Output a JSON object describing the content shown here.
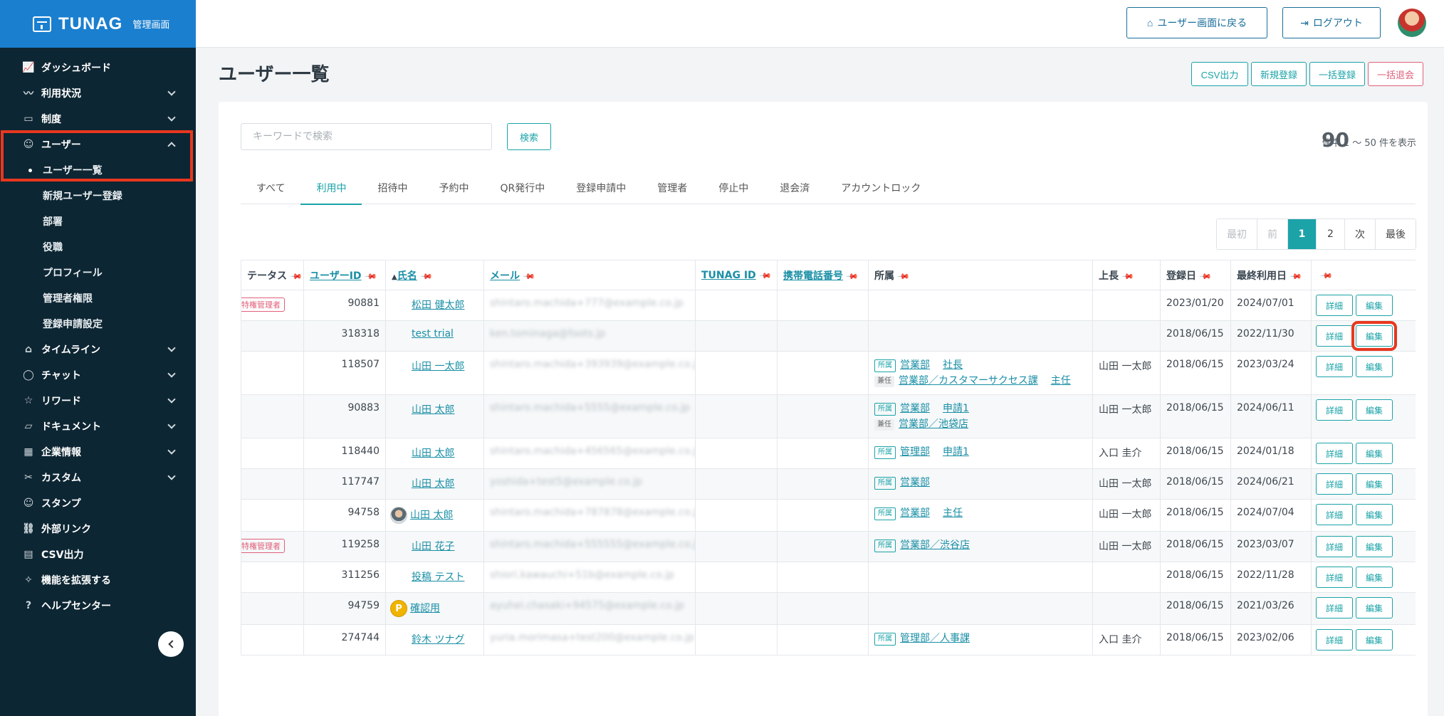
{
  "brand": {
    "name": "TUNAG",
    "sub": "管理画面"
  },
  "sidebar": {
    "items": [
      {
        "label": "ダッシュボード",
        "icon": "chart-icon",
        "glyph": "📈",
        "chevron": "none"
      },
      {
        "label": "利用状況",
        "icon": "activity-icon",
        "glyph": "〰",
        "chevron": "down"
      },
      {
        "label": "制度",
        "icon": "book-icon",
        "glyph": "▭",
        "chevron": "down"
      },
      {
        "label": "ユーザー",
        "icon": "users-icon",
        "glyph": "☺",
        "chevron": "up"
      }
    ],
    "user_sub": [
      "ユーザー一覧",
      "新規ユーザー登録",
      "部署",
      "役職",
      "プロフィール",
      "管理者権限",
      "登録申請設定"
    ],
    "bottom_items": [
      {
        "label": "タイムライン",
        "icon": "home-icon",
        "glyph": "⌂",
        "chevron": "down"
      },
      {
        "label": "チャット",
        "icon": "chat-icon",
        "glyph": "◯",
        "chevron": "down"
      },
      {
        "label": "リワード",
        "icon": "star-icon",
        "glyph": "☆",
        "chevron": "down"
      },
      {
        "label": "ドキュメント",
        "icon": "folder-icon",
        "glyph": "▱",
        "chevron": "down"
      },
      {
        "label": "企業情報",
        "icon": "building-icon",
        "glyph": "▦",
        "chevron": "down"
      },
      {
        "label": "カスタム",
        "icon": "custom-icon",
        "glyph": "✂",
        "chevron": "down"
      },
      {
        "label": "スタンプ",
        "icon": "smile-icon",
        "glyph": "☺",
        "chevron": "none"
      },
      {
        "label": "外部リンク",
        "icon": "link-icon",
        "glyph": "⛓",
        "chevron": "none"
      },
      {
        "label": "CSV出力",
        "icon": "table-icon",
        "glyph": "▤",
        "chevron": "none"
      },
      {
        "label": "機能を拡張する",
        "icon": "sparkle-icon",
        "glyph": "✧",
        "chevron": "none"
      },
      {
        "label": "ヘルプセンター",
        "icon": "help-icon",
        "glyph": "?",
        "chevron": "none"
      }
    ]
  },
  "topbar": {
    "back_label": "ユーザー画面に戻る",
    "logout_label": "ログアウト"
  },
  "page": {
    "title": "ユーザー一覧",
    "actions": {
      "csv": "CSV出力",
      "new": "新規登録",
      "bulk": "一括登録",
      "bulk_withdraw": "一括退会"
    }
  },
  "search": {
    "placeholder": "キーワードで検索",
    "button": "検索"
  },
  "summary": {
    "count": "90",
    "text": "件中 1 〜 50 件を表示"
  },
  "tabs": [
    "すべて",
    "利用中",
    "招待中",
    "予約中",
    "QR発行中",
    "登録申請中",
    "管理者",
    "停止中",
    "退会済",
    "アカウントロック"
  ],
  "active_tab": 1,
  "pagination": {
    "first": "最初",
    "prev": "前",
    "pages": [
      "1",
      "2"
    ],
    "current": "1",
    "next": "次",
    "last": "最後"
  },
  "table": {
    "headers": {
      "status": "テータス",
      "user_id": "ユーザーID",
      "name": "氏名",
      "email": "メール",
      "tunag_id": "TUNAG ID",
      "phone": "携帯電話番号",
      "affiliation": "所属",
      "manager": "上長",
      "registered": "登録日",
      "last_used": "最終利用日"
    },
    "labels": {
      "primary": "所属",
      "secondary": "兼任",
      "detail": "詳細",
      "edit": "編集"
    },
    "rows": [
      {
        "status": "特権管理者",
        "id": "90881",
        "name": "松田 健太郎",
        "avatar": "",
        "email": "shintaro.machida+777@example.co.jp",
        "aff": [],
        "manager": "",
        "reg": "2023/01/20",
        "last": "2024/07/01"
      },
      {
        "status": "",
        "id": "318318",
        "name": "test trial",
        "avatar": "",
        "email": "ken.tominaga@foots.jp",
        "aff": [],
        "manager": "",
        "reg": "2018/06/15",
        "last": "2022/11/30"
      },
      {
        "status": "",
        "id": "118507",
        "name": "山田 一太郎",
        "avatar": "",
        "email": "shintaro.machida+393939@example.co.jp",
        "aff": [
          {
            "kind": "primary",
            "dept": "営業部",
            "pos": "社長"
          },
          {
            "kind": "secondary",
            "dept": "営業部／カスタマーサクセス課",
            "pos": "主任"
          }
        ],
        "manager": "山田 一太郎",
        "reg": "2018/06/15",
        "last": "2023/03/24"
      },
      {
        "status": "",
        "id": "90883",
        "name": "山田 太郎",
        "avatar": "",
        "email": "shintaro.machida+5555@example.co.jp",
        "aff": [
          {
            "kind": "primary",
            "dept": "営業部",
            "pos": "申請1"
          },
          {
            "kind": "secondary",
            "dept": "営業部／池袋店",
            "pos": ""
          }
        ],
        "manager": "山田 一太郎",
        "reg": "2018/06/15",
        "last": "2024/06/11"
      },
      {
        "status": "",
        "id": "118440",
        "name": "山田 太郎",
        "avatar": "",
        "email": "shintaro.machida+456565@example.co.jp",
        "aff": [
          {
            "kind": "primary",
            "dept": "管理部",
            "pos": "申請1"
          }
        ],
        "manager": "入口 圭介",
        "reg": "2018/06/15",
        "last": "2024/01/18"
      },
      {
        "status": "",
        "id": "117747",
        "name": "山田 太郎",
        "avatar": "",
        "email": "yoshida+test5@example.co.jp",
        "aff": [
          {
            "kind": "primary",
            "dept": "営業部",
            "pos": ""
          }
        ],
        "manager": "山田 一太郎",
        "reg": "2018/06/15",
        "last": "2024/06/21"
      },
      {
        "status": "",
        "id": "94758",
        "name": "山田 太郎",
        "avatar": "photo",
        "email": "shintaro.machida+787878@example.co.jp",
        "aff": [
          {
            "kind": "primary",
            "dept": "営業部",
            "pos": "主任"
          }
        ],
        "manager": "山田 一太郎",
        "reg": "2018/06/15",
        "last": "2024/07/04"
      },
      {
        "status": "特権管理者",
        "id": "119258",
        "name": "山田 花子",
        "avatar": "",
        "email": "shintaro.machida+555555@example.co.jp",
        "aff": [
          {
            "kind": "primary",
            "dept": "営業部／渋谷店",
            "pos": ""
          }
        ],
        "manager": "山田 一太郎",
        "reg": "2018/06/15",
        "last": "2023/03/07"
      },
      {
        "status": "",
        "id": "311256",
        "name": "投稿 テスト",
        "avatar": "",
        "email": "shiori.kawauchi+51b@example.co.jp",
        "aff": [],
        "manager": "",
        "reg": "2018/06/15",
        "last": "2022/11/28"
      },
      {
        "status": "",
        "id": "94759",
        "name": "確認用",
        "avatar": "p",
        "email": "ayuhei.chasaki+94575@example.co.jp",
        "aff": [],
        "manager": "",
        "reg": "2018/06/15",
        "last": "2021/03/26"
      },
      {
        "status": "",
        "id": "274744",
        "name": "鈴木 ツナグ",
        "avatar": "",
        "email": "yuria.morimasa+test200@example.co.jp",
        "aff": [
          {
            "kind": "primary",
            "dept": "管理部／人事課",
            "pos": ""
          }
        ],
        "manager": "入口 圭介",
        "reg": "2018/06/15",
        "last": "2023/02/06"
      }
    ]
  },
  "colors": {
    "sidebar": "#0d2633",
    "brand": "#1a7fcf",
    "accent": "#1ba3a8",
    "danger": "#e0607a",
    "highlight": "#e8371f"
  }
}
